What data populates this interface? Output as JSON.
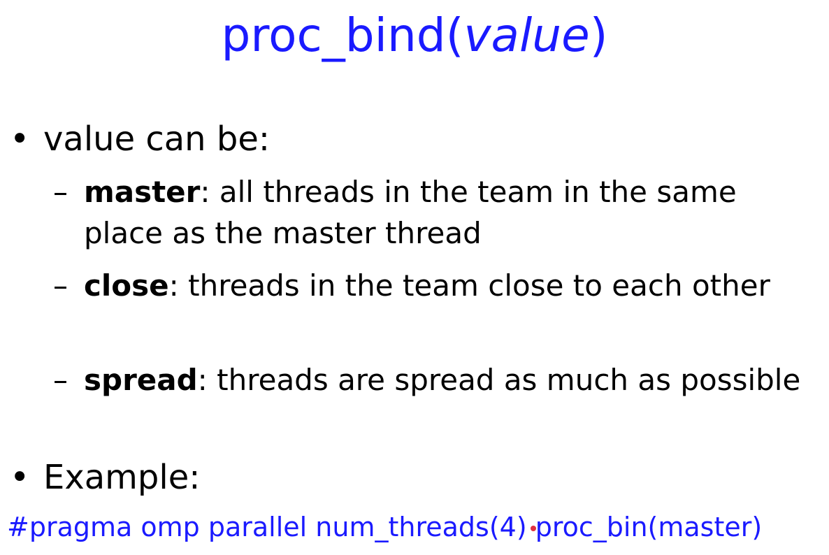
{
  "title": {
    "prefix": "proc_bind(",
    "param": "value",
    "suffix": ")"
  },
  "bullets": [
    {
      "glyph": "•",
      "text": "value can be:"
    },
    {
      "glyph": "•",
      "text": "Example:"
    }
  ],
  "options": [
    {
      "dash": "–",
      "keyword": "master",
      "description": ": all threads in the team in the same place as the master thread"
    },
    {
      "dash": "–",
      "keyword": "close",
      "description": ": threads in the team close to each other"
    },
    {
      "dash": "–",
      "keyword": "spread",
      "description": ": threads are spread as much as possible"
    }
  ],
  "example_code": "#pragma omp parallel num_threads(4) proc_bin(master)",
  "colors": {
    "accent_blue": "#1a1aff",
    "text": "#000000",
    "pointer": "#e03040"
  }
}
